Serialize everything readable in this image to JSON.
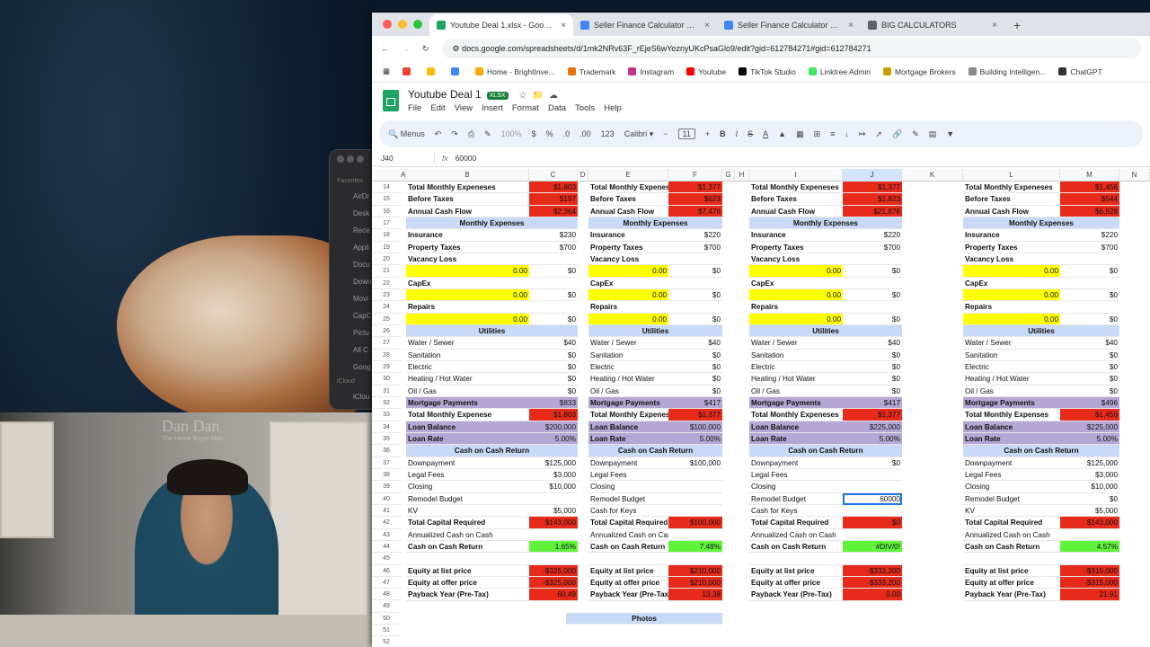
{
  "desktop": {
    "finder_items": [
      "Favorites",
      "AirDr",
      "Desk",
      "Rece",
      "Appli",
      "Docu",
      "Down",
      "Movi",
      "CapC",
      "Pictu",
      "All C",
      "Goog",
      "iCloud",
      "iClou"
    ]
  },
  "webcam": {
    "logo_text": "Dan Dan",
    "logo_sub": "The Home Buyer Man"
  },
  "browser": {
    "tabs": [
      {
        "label": "Youtube Deal 1.xlsx - Google Sh",
        "color": "#1ea362",
        "active": true
      },
      {
        "label": "Seller Finance Calculator — Se",
        "color": "#4285f4",
        "active": false
      },
      {
        "label": "Seller Finance Calculator — Se",
        "color": "#4285f4",
        "active": false
      },
      {
        "label": "BIG CALCULATORS",
        "color": "#5f6368",
        "active": false
      }
    ],
    "url": "docs.google.com/spreadsheets/d/1mk2NRv63F_rEjeS6wYoznyUKcPsaGlo9/edit?gid=612784271#gid=612784271",
    "bookmarks": [
      {
        "label": "Home - BrightInve...",
        "color": "#f9ab00"
      },
      {
        "label": "Trademark",
        "color": "#e8710a"
      },
      {
        "label": "Instagram",
        "color": "#c13584"
      },
      {
        "label": "Youtube",
        "color": "#ff0000"
      },
      {
        "label": "TikTok Studio",
        "color": "#000000"
      },
      {
        "label": "Linktree Admin",
        "color": "#43e660"
      },
      {
        "label": "Mortgage Brokers",
        "color": "#c7a000"
      },
      {
        "label": "Building Intelligen...",
        "color": "#888888"
      },
      {
        "label": "ChatGPT",
        "color": "#333333"
      }
    ]
  },
  "sheet": {
    "title": "Youtube Deal 1",
    "badge": "XLSX",
    "menus": [
      "File",
      "Edit",
      "View",
      "Insert",
      "Format",
      "Data",
      "Tools",
      "Help"
    ],
    "toolbar": {
      "menus": "Menus",
      "zoom": "100%",
      "currency": "$",
      "percent": "%",
      "dec_less": ".0",
      "dec_more": ".00",
      "num": "123",
      "font": "Calibri",
      "font_size": "11"
    },
    "namebox": "J40",
    "formula": "60000",
    "columns": [
      "A",
      "B",
      "C",
      "D",
      "E",
      "F",
      "G",
      "H",
      "I",
      "J",
      "K",
      "L",
      "M",
      "N"
    ],
    "rows": [
      "14",
      "15",
      "16",
      "17",
      "18",
      "19",
      "20",
      "21",
      "22",
      "23",
      "24",
      "25",
      "26",
      "27",
      "28",
      "29",
      "30",
      "31",
      "32",
      "33",
      "34",
      "35",
      "36",
      "37",
      "38",
      "39",
      "40",
      "41",
      "42",
      "43",
      "44",
      "45",
      "46",
      "47",
      "48",
      "49",
      "50",
      "51",
      "52"
    ],
    "blocks": [
      {
        "rows": [
          [
            "Total Monthly Expeneses",
            "$1,803"
          ],
          [
            "Before Taxes",
            "$197"
          ],
          [
            "Annual Cash Flow",
            "$2,364"
          ],
          [
            "Monthly Expenses",
            ""
          ],
          [
            "Insurance",
            "$230"
          ],
          [
            "Property Taxes",
            "$700"
          ],
          [
            "Vacancy Loss",
            ""
          ],
          [
            "0.00",
            "$0"
          ],
          [
            "CapEx",
            ""
          ],
          [
            "0.00",
            "$0"
          ],
          [
            "Repairs",
            ""
          ],
          [
            "0.00",
            "$0"
          ],
          [
            "Utilities",
            ""
          ],
          [
            "Water / Sewer",
            "$40"
          ],
          [
            "Sanitation",
            "$0"
          ],
          [
            "Electric",
            "$0"
          ],
          [
            "Heating / Hot Water",
            "$0"
          ],
          [
            "Oil / Gas",
            "$0"
          ],
          [
            "Mortgage Payments",
            "$833"
          ],
          [
            "Total Monthly Expenese",
            "$1,803"
          ],
          [
            "Loan Balance",
            "$200,000"
          ],
          [
            "Loan Rate",
            "5.00%"
          ],
          [
            "Cash on Cash Return",
            ""
          ],
          [
            "Downpayment",
            "$125,000"
          ],
          [
            "Legal Fees",
            "$3,000"
          ],
          [
            "Closing",
            "$10,000"
          ],
          [
            "Remodel Budget",
            ""
          ],
          [
            "KV",
            "$5,000"
          ],
          [
            "Total Capital Required",
            "$143,000"
          ],
          [
            "Annualized Cash on Cash",
            ""
          ],
          [
            "Cash on Cash Return",
            "1.65%"
          ],
          [
            "",
            ""
          ],
          [
            "Equity at list price",
            "-$325,000"
          ],
          [
            "Equity at offer price",
            "-$325,000"
          ],
          [
            "Payback Year (Pre-Tax)",
            "60.49"
          ]
        ]
      },
      {
        "rows": [
          [
            "Total Monthly Expeneses",
            "$1,377"
          ],
          [
            "Before Taxes",
            "$623"
          ],
          [
            "Annual Cash Flow",
            "$7,476"
          ],
          [
            "Monthly Expenses",
            ""
          ],
          [
            "Insurance",
            "$220"
          ],
          [
            "Property Taxes",
            "$700"
          ],
          [
            "Vacancy Loss",
            ""
          ],
          [
            "0.00",
            "$0"
          ],
          [
            "CapEx",
            ""
          ],
          [
            "0.00",
            "$0"
          ],
          [
            "Repairs",
            ""
          ],
          [
            "0.00",
            "$0"
          ],
          [
            "Utilities",
            ""
          ],
          [
            "Water / Sewer",
            "$40"
          ],
          [
            "Sanitation",
            "$0"
          ],
          [
            "Electric",
            "$0"
          ],
          [
            "Heating / Hot Water",
            "$0"
          ],
          [
            "Oil / Gas",
            "$0"
          ],
          [
            "Mortgage Payments",
            "$417"
          ],
          [
            "Total Monthly Expeneses",
            "$1,377"
          ],
          [
            "Loan Balance",
            "$100,000"
          ],
          [
            "Loan Rate",
            "5.00%"
          ],
          [
            "Cash on Cash Return",
            ""
          ],
          [
            "Downpayment",
            "$100,000"
          ],
          [
            "Legal Fees",
            ""
          ],
          [
            "Closing",
            ""
          ],
          [
            "Remodel Budget",
            ""
          ],
          [
            "Cash for Keys",
            ""
          ],
          [
            "Total Capital Required",
            "$100,000"
          ],
          [
            "Annualized Cash on Cash",
            ""
          ],
          [
            "Cash on Cash Return",
            "7.48%"
          ],
          [
            "",
            ""
          ],
          [
            "Equity at list price",
            "$210,000"
          ],
          [
            "Equity at offer price",
            "$210,000"
          ],
          [
            "Payback Year (Pre-Tax)",
            "13.38"
          ]
        ]
      },
      {
        "rows": [
          [
            "Total Monthly Expeneses",
            "$1,377"
          ],
          [
            "Before Taxes",
            "$1,823"
          ],
          [
            "Annual Cash Flow",
            "$21,876"
          ],
          [
            "Monthly Expenses",
            ""
          ],
          [
            "Insurance",
            "$220"
          ],
          [
            "Property Taxes",
            "$700"
          ],
          [
            "Vacancy Loss",
            ""
          ],
          [
            "0.00",
            "$0"
          ],
          [
            "CapEx",
            ""
          ],
          [
            "0.00",
            "$0"
          ],
          [
            "Repairs",
            ""
          ],
          [
            "0.00",
            "$0"
          ],
          [
            "Utilities",
            ""
          ],
          [
            "Water / Sewer",
            "$40"
          ],
          [
            "Sanitation",
            "$0"
          ],
          [
            "Electric",
            "$0"
          ],
          [
            "Heating / Hot Water",
            "$0"
          ],
          [
            "Oil / Gas",
            "$0"
          ],
          [
            "Mortgage Payments",
            "$417"
          ],
          [
            "Total Monthly Expeneses",
            "$1,377"
          ],
          [
            "Loan Balance",
            "$225,000"
          ],
          [
            "Loan Rate",
            "5.00%"
          ],
          [
            "Cash on Cash Return",
            ""
          ],
          [
            "Downpayment",
            "$0"
          ],
          [
            "Legal Fees",
            ""
          ],
          [
            "Closing",
            ""
          ],
          [
            "Remodel Budget",
            "60000"
          ],
          [
            "Cash for Keys",
            ""
          ],
          [
            "Total Capital Required",
            "$0"
          ],
          [
            "Annualized Cash on Cash",
            ""
          ],
          [
            "Cash on Cash Return",
            "#DIV/0!"
          ],
          [
            "",
            ""
          ],
          [
            "Equity at list price",
            "-$333,200"
          ],
          [
            "Equity at offer price",
            "-$333,200"
          ],
          [
            "Payback Year (Pre-Tax)",
            "0.00"
          ]
        ]
      },
      {
        "rows": [
          [
            "Total Monthly Expeneses",
            "$1,456"
          ],
          [
            "Before Taxes",
            "$544"
          ],
          [
            "Annual Cash Flow",
            "$6,528"
          ],
          [
            "Monthly Expenses",
            ""
          ],
          [
            "Insurance",
            "$220"
          ],
          [
            "Property Taxes",
            "$700"
          ],
          [
            "Vacancy Loss",
            ""
          ],
          [
            "0.00",
            "$0"
          ],
          [
            "CapEx",
            ""
          ],
          [
            "0.00",
            "$0"
          ],
          [
            "Repairs",
            ""
          ],
          [
            "0.00",
            "$0"
          ],
          [
            "Utilities",
            ""
          ],
          [
            "Water / Sewer",
            "$40"
          ],
          [
            "Sanitation",
            "$0"
          ],
          [
            "Electric",
            "$0"
          ],
          [
            "Heating / Hot Water",
            "$0"
          ],
          [
            "Oil / Gas",
            "$0"
          ],
          [
            "Mortgage Payments",
            "$496"
          ],
          [
            "Total Monthly Expenses",
            "$1,456"
          ],
          [
            "Loan Balance",
            "$225,000"
          ],
          [
            "Loan Rate",
            "5.00%"
          ],
          [
            "Cash on Cash Return",
            ""
          ],
          [
            "Downpayment",
            "$125,000"
          ],
          [
            "Legal Fees",
            "$3,000"
          ],
          [
            "Closing",
            "$10,000"
          ],
          [
            "Remodel Budget",
            "$0"
          ],
          [
            "KV",
            "$5,000"
          ],
          [
            "Total Capital Required",
            "$143,000"
          ],
          [
            "Annualized Cash on Cash",
            ""
          ],
          [
            "Cash on Cash Return",
            "4.57%"
          ],
          [
            "",
            ""
          ],
          [
            "Equity at list price",
            "-$315,000"
          ],
          [
            "Equity at offer price",
            "-$315,000"
          ],
          [
            "Payback Year (Pre-Tax)",
            "21.91"
          ]
        ]
      }
    ],
    "photos_label": "Photos"
  }
}
